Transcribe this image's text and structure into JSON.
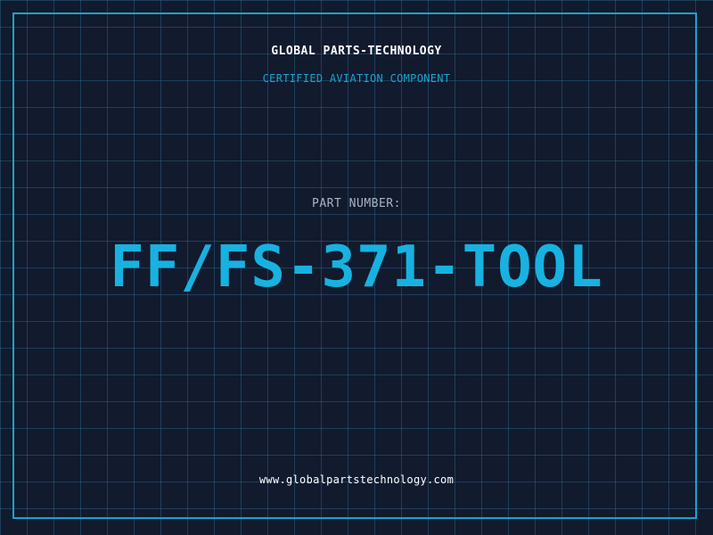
{
  "company": "GLOBAL PARTS-TECHNOLOGY",
  "tagline": "CERTIFIED AVIATION COMPONENT",
  "part_number_label": "PART NUMBER:",
  "part_number": "FF/FS-371-TOOL",
  "website": "www.globalpartstechnology.com",
  "colors": {
    "background": "#121a2e",
    "grid": "#286e8c",
    "accent": "#17b2e0",
    "frame": "#1aa3d0",
    "label": "#a9b3c2",
    "text": "#ffffff"
  }
}
